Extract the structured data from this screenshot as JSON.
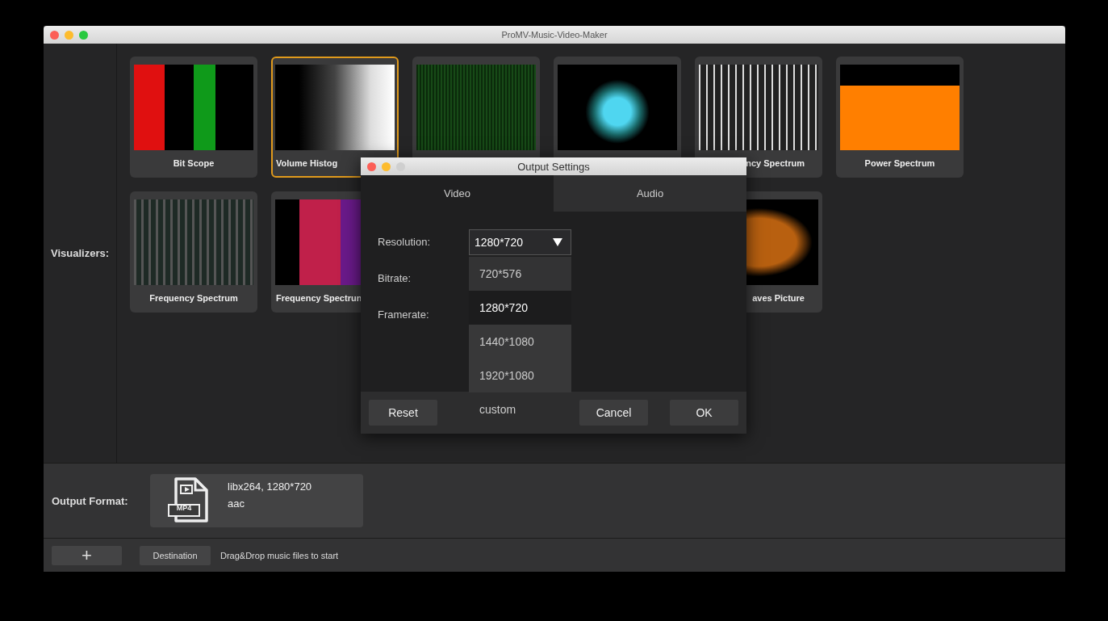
{
  "window": {
    "title": "ProMV-Music-Video-Maker"
  },
  "visualizers": {
    "label": "Visualizers:",
    "rows": [
      [
        {
          "label": "Bit Scope",
          "kind": "bits",
          "selected": false
        },
        {
          "label": "Volume Histog",
          "kind": "histogram",
          "selected": true
        },
        {
          "kind": "green",
          "selected": false
        },
        {
          "kind": "particles",
          "selected": false
        },
        {
          "label": "ncy Spectrum",
          "kind": "spectrum3d",
          "selected": false
        },
        {
          "label": "Power Spectrum",
          "kind": "power",
          "selected": false
        }
      ],
      [
        {
          "label": "Frequency Spectrum",
          "kind": "spectrogram",
          "selected": false
        },
        {
          "label": "Frequency Spectrun",
          "kind": "heatmap",
          "selected": false
        },
        {
          "label": "aves Picture",
          "kind": "waves",
          "selected": false
        }
      ]
    ]
  },
  "output_format": {
    "label": "Output Format:",
    "badge": "MP4",
    "video": "libx264, 1280*720",
    "audio": "aac"
  },
  "bottom_bar": {
    "add": "+",
    "destination": "Destination",
    "hint": "Drag&Drop music files to start"
  },
  "dialog": {
    "title": "Output Settings",
    "tabs": [
      {
        "label": "Video",
        "selected": true
      },
      {
        "label": "Audio",
        "selected": false
      }
    ],
    "fields": [
      {
        "label": "Resolution:"
      },
      {
        "label": "Bitrate:"
      },
      {
        "label": "Framerate:"
      }
    ],
    "resolution": {
      "value": "1280*720",
      "expanded": true,
      "options": [
        {
          "label": "720*576",
          "selected": false
        },
        {
          "label": "1280*720",
          "selected": true
        },
        {
          "label": "1440*1080",
          "selected": false
        },
        {
          "label": "1920*1080",
          "selected": false
        },
        {
          "label": "custom",
          "selected": false
        }
      ]
    },
    "buttons": {
      "reset": "Reset",
      "cancel": "Cancel",
      "ok": "OK"
    }
  }
}
